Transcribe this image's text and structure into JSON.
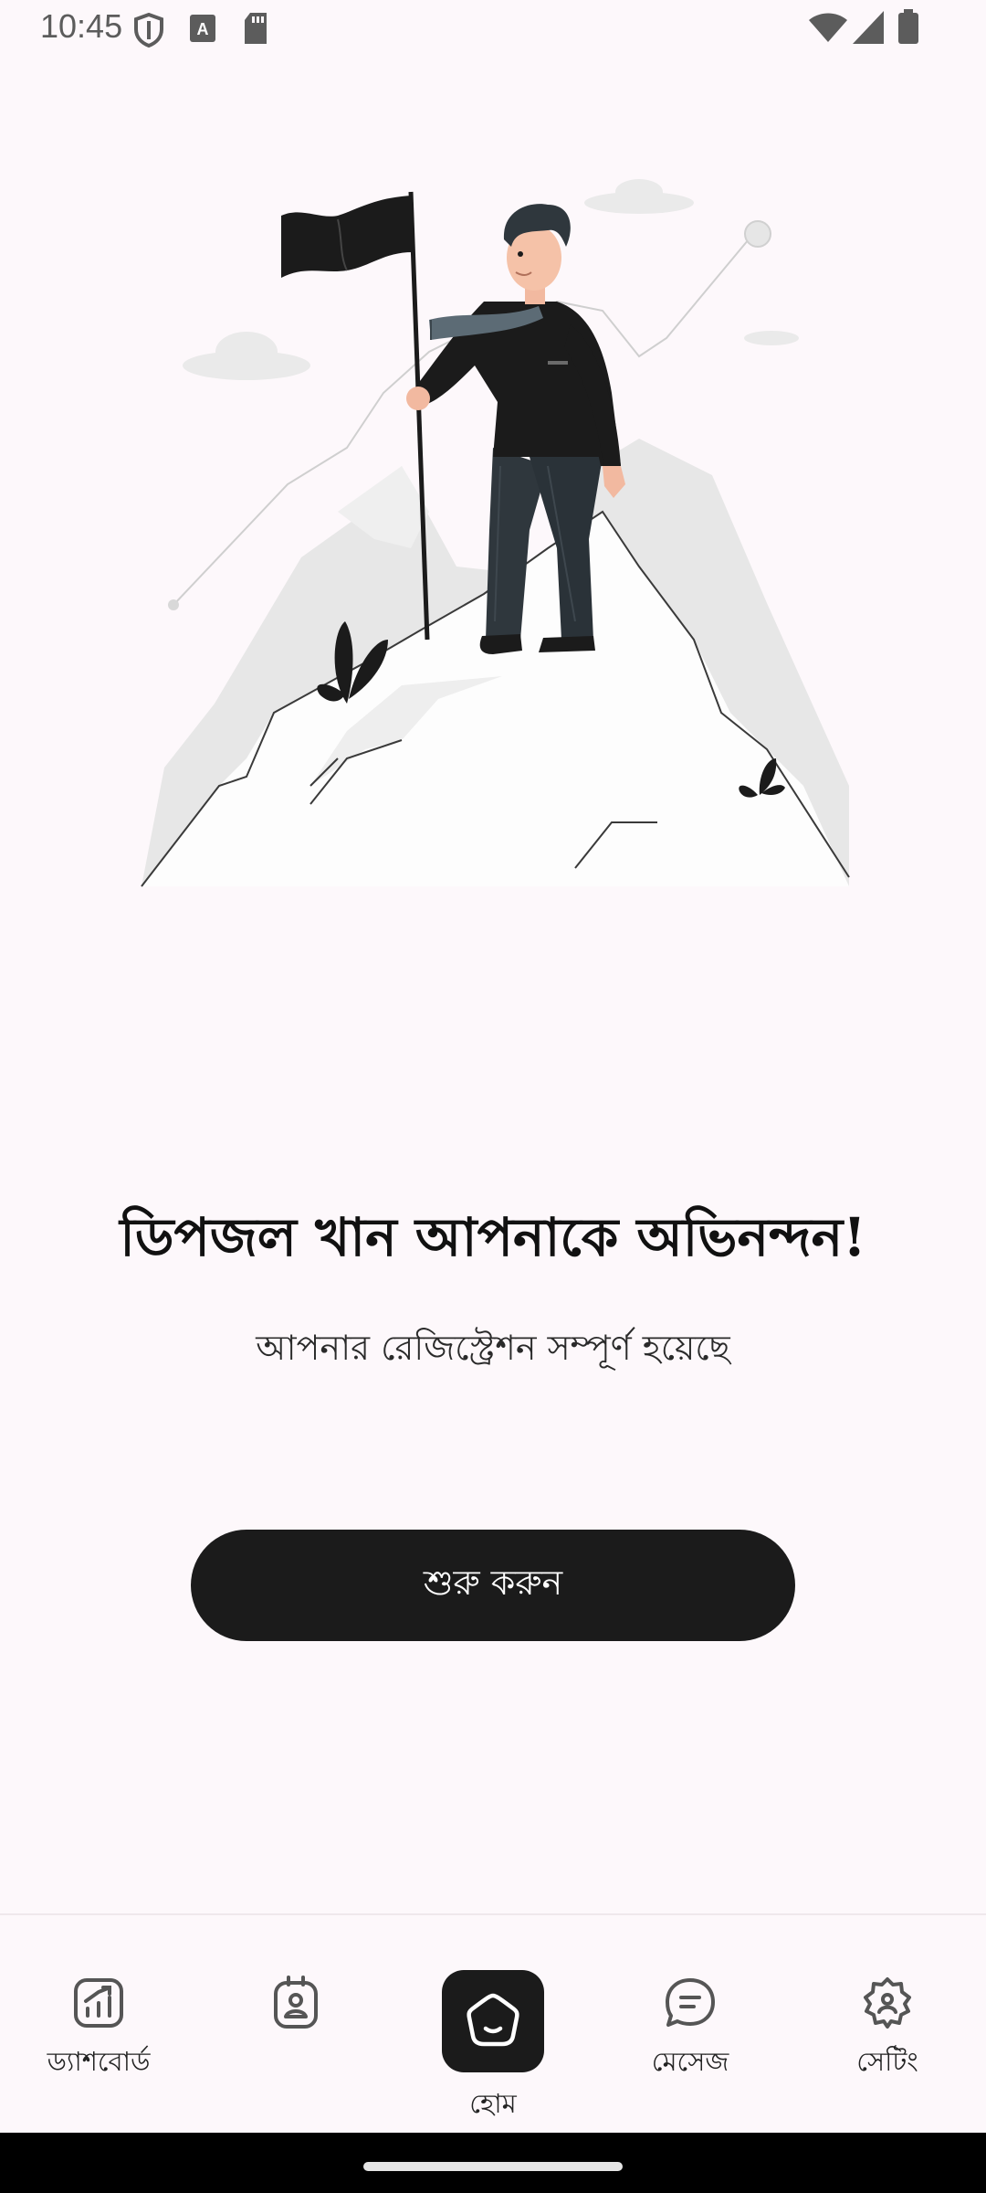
{
  "status_bar": {
    "time": "10:45",
    "icons_left": [
      "shield-icon",
      "text-a-icon",
      "sd-card-icon"
    ],
    "icons_right": [
      "wifi-icon",
      "cell-signal-icon",
      "battery-icon"
    ]
  },
  "illustration": {
    "description_icon": "mountain-summit-flag-illustration"
  },
  "main": {
    "headline": "ডিপজল খান আপনাকে অভিনন্দন!",
    "subline": "আপনার রেজিস্ট্রেশন সম্পূর্ণ হয়েছে",
    "start_button_label": "শুরু করুন"
  },
  "bottom_nav": {
    "items": [
      {
        "label": "ড্যাশবোর্ড",
        "icon": "chart-up-icon"
      },
      {
        "label": "",
        "icon": "id-badge-icon"
      },
      {
        "label": "হোম",
        "icon": "home-icon",
        "active": true
      },
      {
        "label": "মেসেজ",
        "icon": "chat-bubble-icon"
      },
      {
        "label": "সেটিং",
        "icon": "settings-gear-icon"
      }
    ]
  },
  "colors": {
    "background": "#fdf8fb",
    "primary_dark": "#1b1b1b",
    "icon_gray": "#555555"
  }
}
